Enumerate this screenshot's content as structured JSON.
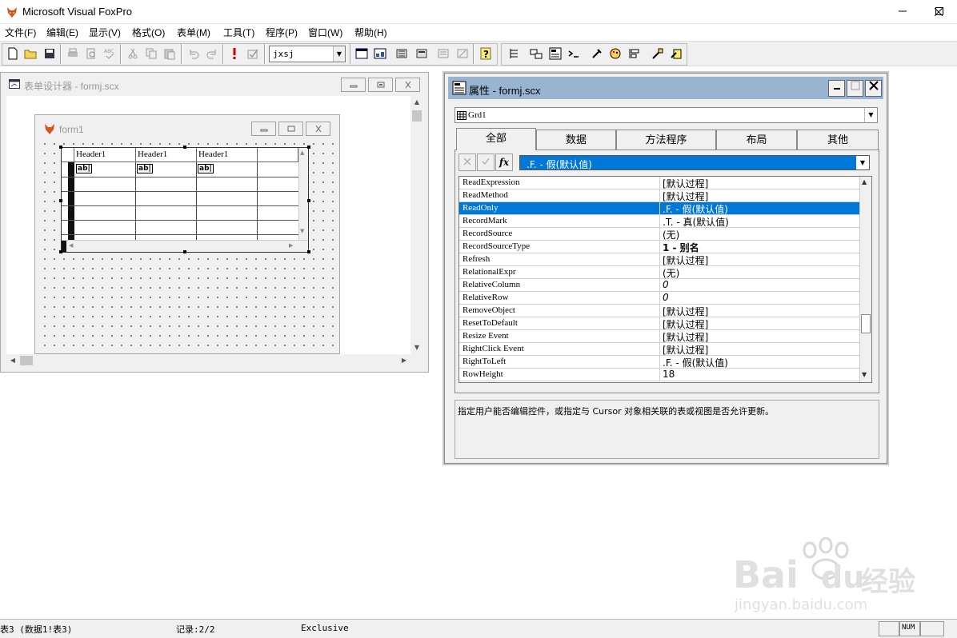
{
  "app": {
    "title": "Microsoft Visual FoxPro"
  },
  "menu": [
    "文件(F)",
    "编辑(E)",
    "显示(V)",
    "格式(O)",
    "表单(M)",
    "工具(T)",
    "程序(P)",
    "窗口(W)",
    "帮助(H)"
  ],
  "toolbar": {
    "database_combo": "jxsj"
  },
  "designer": {
    "title": "表单设计器 - formj.scx",
    "form_title": "form1",
    "grid_headers": [
      "Header1",
      "Header1",
      "Header1"
    ],
    "textbox_glyph": "ab|"
  },
  "properties": {
    "title": "属性 - formj.scx",
    "object": "Grd1",
    "tabs": [
      "全部",
      "数据",
      "方法程序",
      "布局",
      "其他"
    ],
    "active_tab": 0,
    "fx_label": "fx",
    "current_value": ".F. - 假(默认值)",
    "rows": [
      {
        "name": "ReadExpression",
        "value": "[默认过程]"
      },
      {
        "name": "ReadMethod",
        "value": "[默认过程]"
      },
      {
        "name": "ReadOnly",
        "value": ".F. - 假(默认值)",
        "selected": true
      },
      {
        "name": "RecordMark",
        "value": ".T. - 真(默认值)"
      },
      {
        "name": "RecordSource",
        "value": "(无)"
      },
      {
        "name": "RecordSourceType",
        "value": "1 - 别名",
        "bold": true
      },
      {
        "name": "Refresh",
        "value": "[默认过程]"
      },
      {
        "name": "RelationalExpr",
        "value": "(无)"
      },
      {
        "name": "RelativeColumn",
        "value": "0"
      },
      {
        "name": "RelativeRow",
        "value": "0"
      },
      {
        "name": "RemoveObject",
        "value": "[默认过程]"
      },
      {
        "name": "ResetToDefault",
        "value": "[默认过程]"
      },
      {
        "name": "Resize Event",
        "value": "[默认过程]"
      },
      {
        "name": "RightClick Event",
        "value": "[默认过程]"
      },
      {
        "name": "RightToLeft",
        "value": ".F. - 假(默认值)"
      },
      {
        "name": "RowHeight",
        "value": "18"
      }
    ],
    "description": "指定用户能否编辑控件，或指定与 Cursor 对象相关联的表或视图是否允许更新。"
  },
  "status": {
    "table": "表3 (数据1!表3)",
    "record": "记录:2/2",
    "mode": "Exclusive",
    "num": "NUM"
  },
  "watermark": {
    "brand": "Bai",
    "brand2": "经验",
    "url": "jingyan.baidu.com"
  },
  "colors": {
    "accent": "#0078d7",
    "titlebar_inactive": "#99b4d1"
  }
}
